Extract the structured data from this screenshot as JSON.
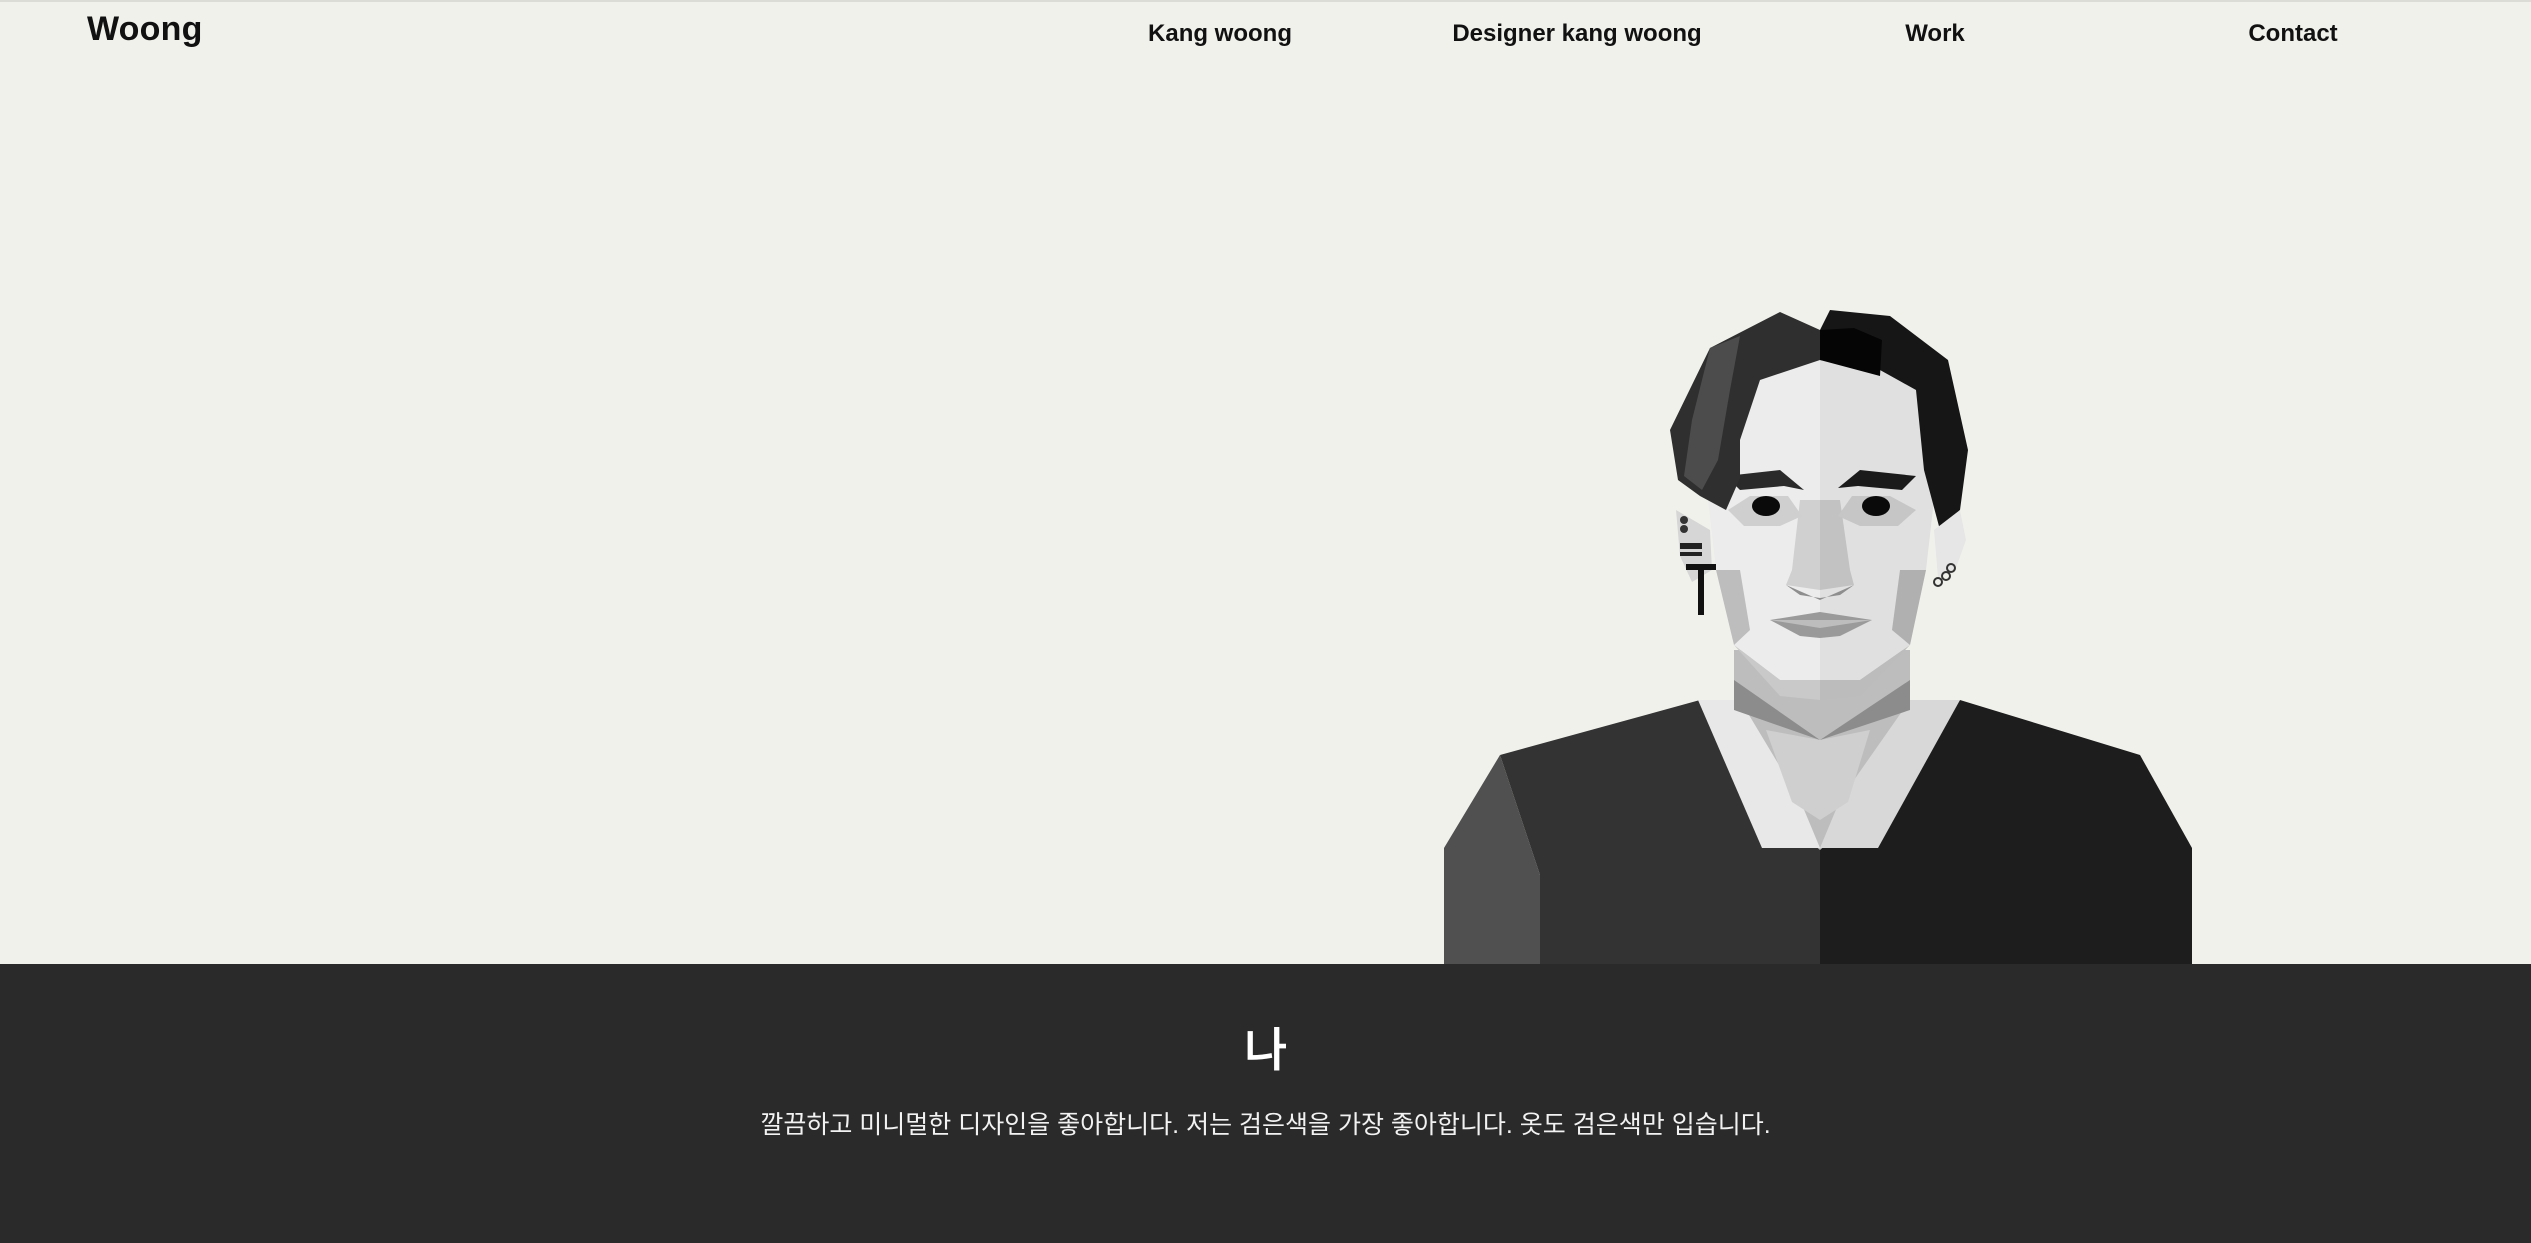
{
  "header": {
    "logo": "Woong",
    "nav": [
      "Kang woong",
      "Designer kang woong",
      "Work",
      "Contact"
    ]
  },
  "hero": {
    "illustration_icon": "portrait-illustration"
  },
  "about": {
    "title": "나",
    "text": "깔끔하고 미니멀한 디자인을 좋아합니다. 저는 검은색을 가장 좋아합니다. 옷도 검은색만 입습니다."
  },
  "colors": {
    "background": "#f1f1ec",
    "about_background": "#2a2a2a",
    "text": "#111111"
  }
}
